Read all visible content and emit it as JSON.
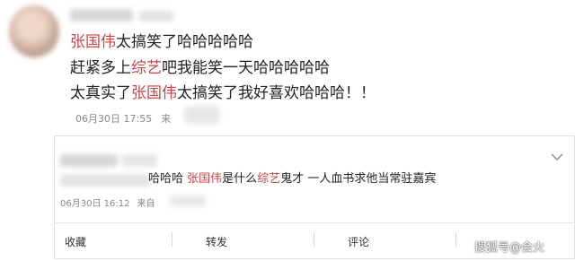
{
  "post": {
    "lines": [
      {
        "highlight": "张国伟",
        "rest": "太搞笑了哈哈哈哈哈"
      },
      {
        "pre": "赶紧多上",
        "highlight": "综艺",
        "rest": "吧我能笑一天哈哈哈哈哈"
      },
      {
        "pre": "太真实了",
        "highlight": "张国伟",
        "rest": "太搞笑了我好喜欢哈哈哈！！"
      }
    ],
    "date": "06月30日 17:55",
    "source_label": "来"
  },
  "comment": {
    "prefix": "哈哈哈",
    "name1": "张国伟",
    "mid": "是什么",
    "name2": "综艺",
    "suffix": "鬼才 一人血书求他当常驻嘉宾",
    "date": "06月30日 16:12",
    "source_label": "来自"
  },
  "actions": {
    "favorite": "收藏",
    "forward": "转发",
    "comment": "评论"
  },
  "watermark": "搜狐号@会火",
  "colors": {
    "highlight": "#c9454a",
    "meta": "#8a8a8a",
    "border": "#dedede"
  },
  "icons": {
    "expand": "chevron-down-icon"
  }
}
